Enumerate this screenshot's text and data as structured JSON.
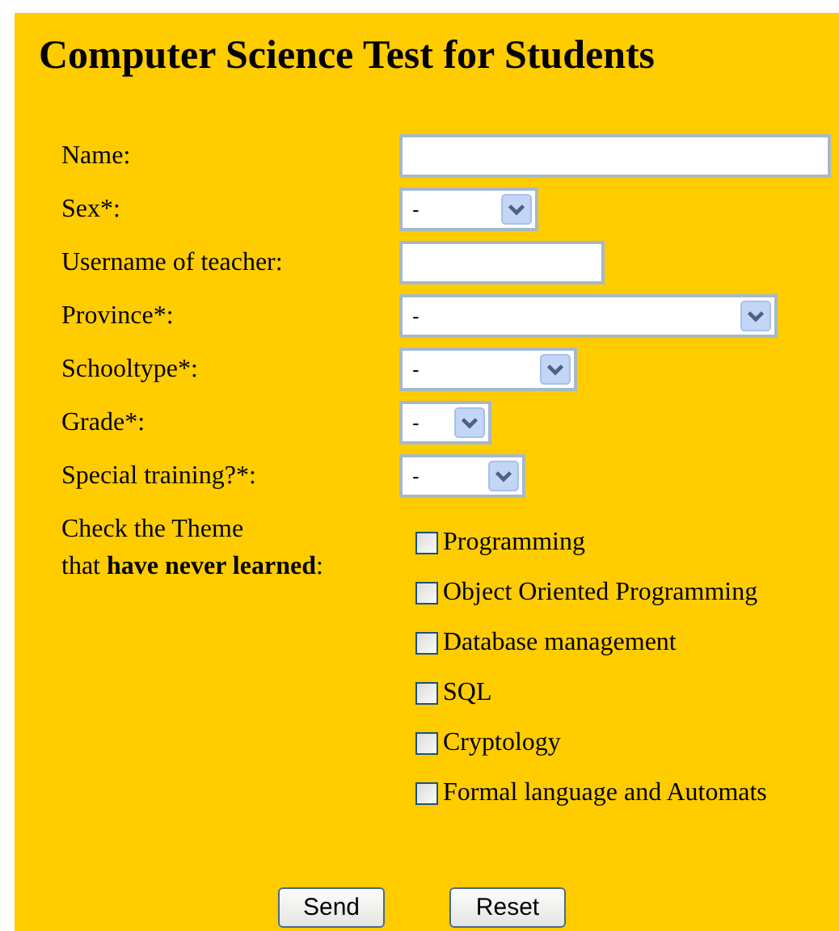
{
  "title": "Computer Science Test for Students",
  "fields": [
    {
      "label": "Name:",
      "kind": "text"
    },
    {
      "label": "Sex*:",
      "kind": "select",
      "value": "-"
    },
    {
      "label": "Username of teacher:",
      "kind": "text"
    },
    {
      "label": "Province*:",
      "kind": "select",
      "value": "-"
    },
    {
      "label": "Schooltype*:",
      "kind": "select",
      "value": "-"
    },
    {
      "label": "Grade*:",
      "kind": "select",
      "value": "-"
    },
    {
      "label": "Special training?*:",
      "kind": "select",
      "value": "-"
    }
  ],
  "themes": {
    "label_lines": [
      "Check the Theme",
      "that **have never learned**:"
    ],
    "options": [
      {
        "label": "Programming",
        "checked": false
      },
      {
        "label": "Object Oriented Programming",
        "checked": false
      },
      {
        "label": "Database management",
        "checked": false
      },
      {
        "label": "SQL",
        "checked": false
      },
      {
        "label": "Cryptology",
        "checked": false
      },
      {
        "label": "Formal language and Automats",
        "checked": false
      }
    ]
  },
  "buttons": [
    "Send",
    "Reset"
  ]
}
